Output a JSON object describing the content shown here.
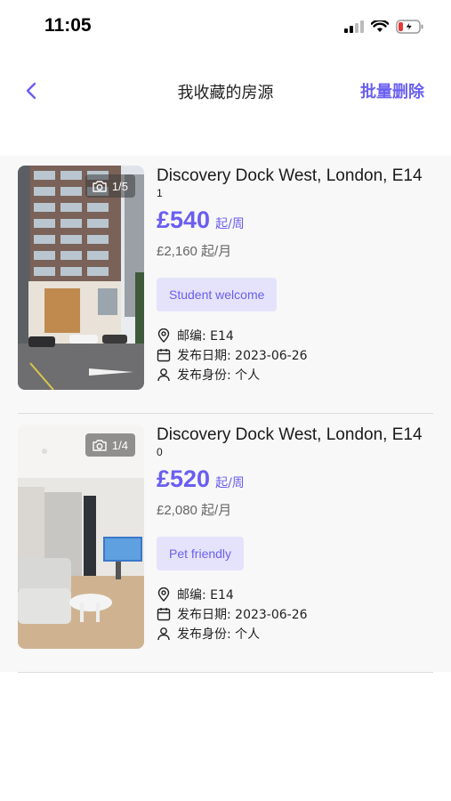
{
  "status_bar": {
    "time": "11:05"
  },
  "nav": {
    "title": "我收藏的房源",
    "batch_delete": "批量删除"
  },
  "listings": [
    {
      "title": "Discovery Dock West, London, E14",
      "sub_number": "1",
      "price": "£540",
      "price_unit": "起/周",
      "monthly": "£2,160 起/月",
      "photo_count": "1/5",
      "tag": "Student welcome",
      "postcode": "邮编: E14",
      "publish_date": "发布日期: 2023-06-26",
      "publisher": "发布身份: 个人"
    },
    {
      "title": "Discovery Dock West, London, E14",
      "sub_number": "0",
      "price": "£520",
      "price_unit": "起/周",
      "monthly": "£2,080 起/月",
      "photo_count": "1/4",
      "tag": "Pet friendly",
      "postcode": "邮编: E14",
      "publish_date": "发布日期: 2023-06-26",
      "publisher": "发布身份: 个人"
    }
  ],
  "colors": {
    "accent": "#6a5ff0",
    "tag_bg": "#e5e3fb"
  }
}
